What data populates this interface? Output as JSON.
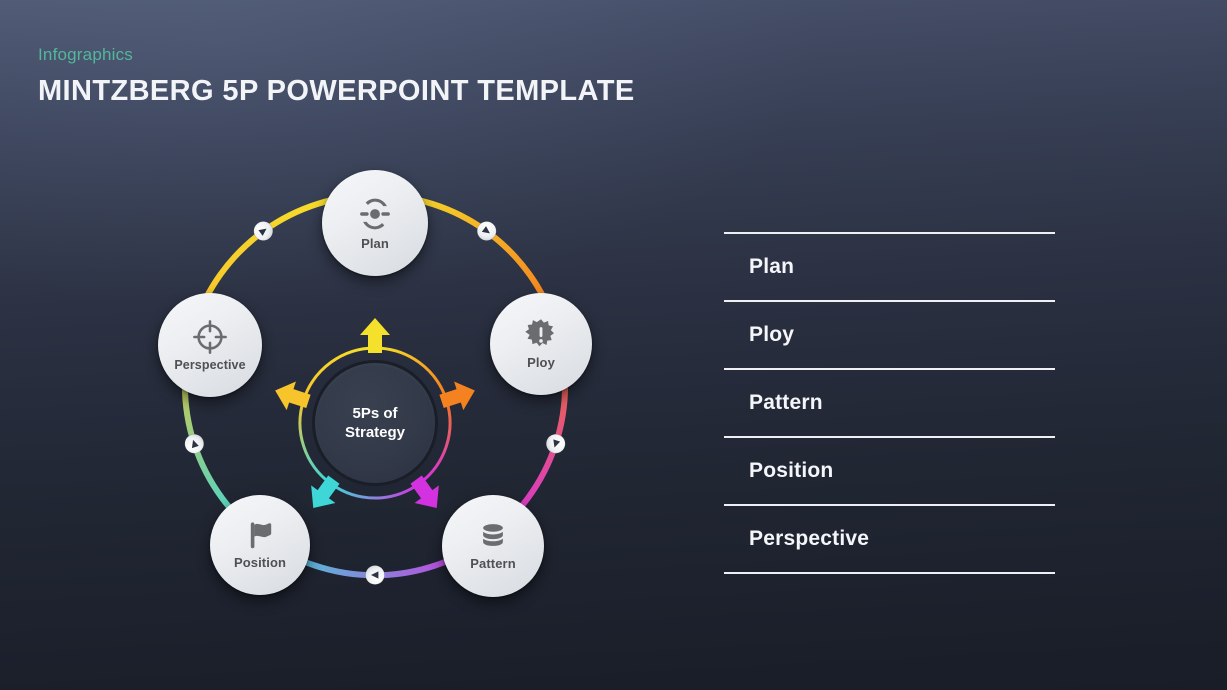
{
  "header": {
    "eyebrow": "Infographics",
    "title": "MINTZBERG 5P POWERPOINT TEMPLATE"
  },
  "diagram": {
    "hub_label": "5Ps of\nStrategy",
    "nodes": [
      {
        "id": "plan",
        "label": "Plan",
        "icon": "cycle-target-icon",
        "color": "#f5e02b"
      },
      {
        "id": "ploy",
        "label": "Ploy",
        "icon": "alert-burst-icon",
        "color": "#f58220"
      },
      {
        "id": "pattern",
        "label": "Pattern",
        "icon": "database-icon",
        "color": "#d431e0"
      },
      {
        "id": "position",
        "label": "Position",
        "icon": "flag-icon",
        "color": "#3ed6d6"
      },
      {
        "id": "perspective",
        "label": "Perspective",
        "icon": "crosshair-icon",
        "color": "#f7c52b"
      }
    ],
    "ring_colors": {
      "yellow": "#f5e02b",
      "orange": "#f58220",
      "magenta": "#d431e0",
      "cyan": "#3ed6d6",
      "gold": "#f7c52b"
    }
  },
  "list": {
    "items": [
      {
        "label": "Plan"
      },
      {
        "label": "Ploy"
      },
      {
        "label": "Pattern"
      },
      {
        "label": "Position"
      },
      {
        "label": "Perspective"
      }
    ]
  },
  "theme": {
    "accent": "#52b79c",
    "text": "#f2f4f8",
    "bg_top": "#4c5670",
    "bg_bottom": "#191d27"
  }
}
